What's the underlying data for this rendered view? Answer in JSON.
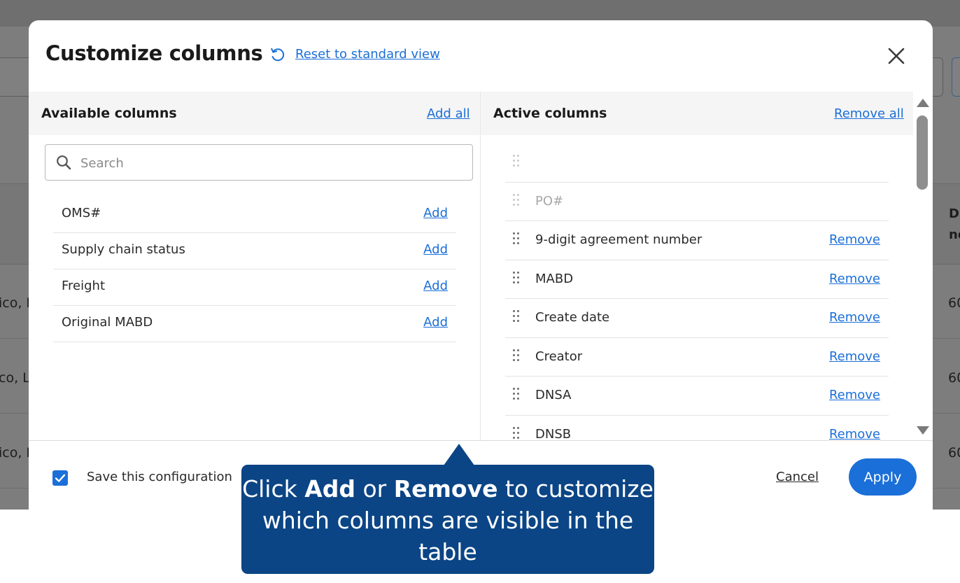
{
  "background": {
    "rows": [
      {
        "left_text": "ico, L",
        "right_text": "60"
      },
      {
        "left_text": "co, Lt",
        "right_text": "60"
      },
      {
        "left_text": "ico, L",
        "right_text": "60"
      }
    ],
    "header_right": [
      "D",
      "no"
    ]
  },
  "modal": {
    "title": "Customize columns",
    "reset_link": "Reset to standard view",
    "close_icon": "close-icon"
  },
  "available": {
    "title": "Available columns",
    "action": "Add all",
    "search_placeholder": "Search",
    "search_value": "",
    "items": [
      {
        "label": "OMS#",
        "action": "Add"
      },
      {
        "label": "Supply chain status",
        "action": "Add"
      },
      {
        "label": "Freight",
        "action": "Add"
      },
      {
        "label": "Original MABD",
        "action": "Add"
      }
    ]
  },
  "active": {
    "title": "Active columns",
    "action": "Remove all",
    "items": [
      {
        "label": "",
        "action": "",
        "locked": true
      },
      {
        "label": "PO#",
        "action": "",
        "locked": true
      },
      {
        "label": "9-digit agreement number",
        "action": "Remove",
        "locked": false
      },
      {
        "label": "MABD",
        "action": "Remove",
        "locked": false
      },
      {
        "label": "Create date",
        "action": "Remove",
        "locked": false
      },
      {
        "label": "Creator",
        "action": "Remove",
        "locked": false
      },
      {
        "label": "DNSA",
        "action": "Remove",
        "locked": false
      },
      {
        "label": "DNSB",
        "action": "Remove",
        "locked": false
      }
    ]
  },
  "footer": {
    "save_label": "Save this configuration",
    "save_checked": true,
    "cancel": "Cancel",
    "apply": "Apply"
  },
  "callout": {
    "part1": "Click ",
    "bold1": "Add",
    "part2": " or ",
    "bold2": "Remove",
    "part3": " to customize which columns are visible in the table"
  },
  "colors": {
    "accent": "#1b6fd8",
    "callout_bg": "#0b4585",
    "overlay": "#7d7d7d"
  }
}
